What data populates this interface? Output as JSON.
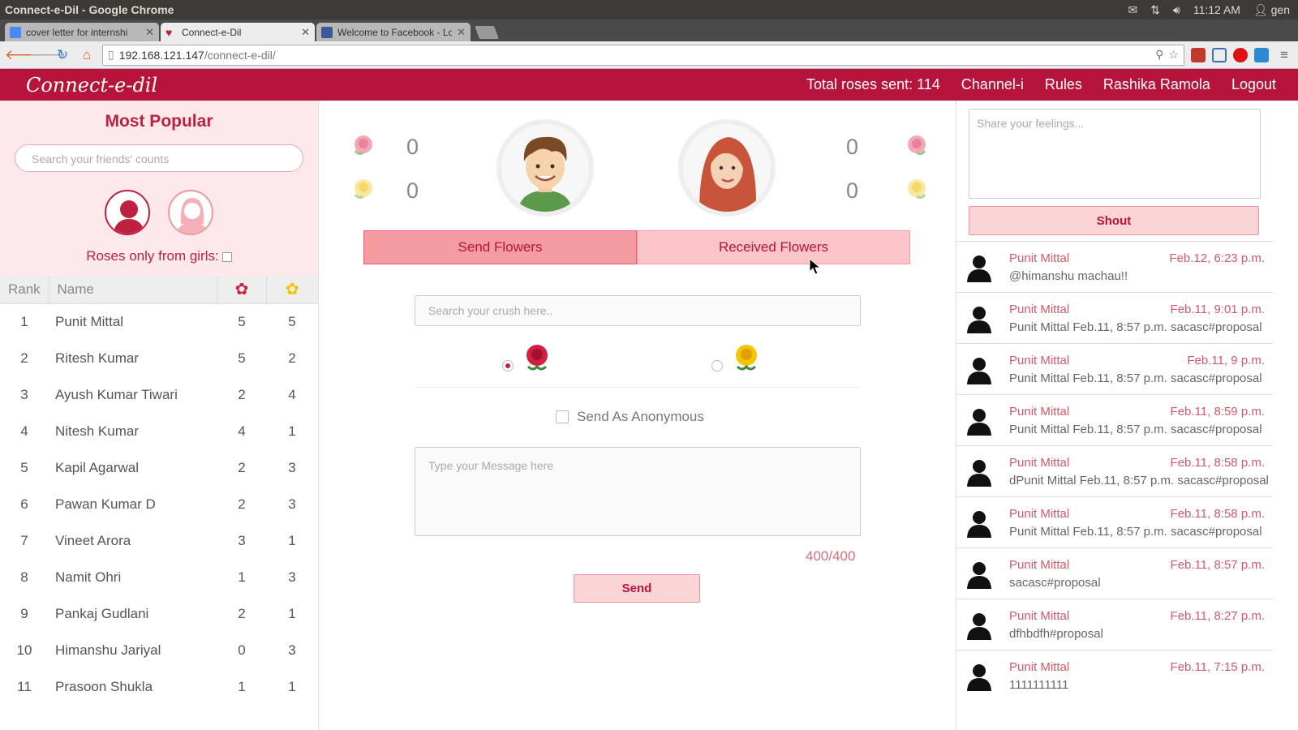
{
  "os": {
    "window_title": "Connect-e-Dil - Google Chrome",
    "time": "11:12 AM",
    "user": "gen"
  },
  "browser": {
    "tabs": [
      {
        "label": "cover letter for internshi",
        "active": false
      },
      {
        "label": "Connect-e-Dil",
        "active": true
      },
      {
        "label": "Welcome to Facebook - Lo",
        "active": false
      }
    ],
    "url_host": "192.168.121.147",
    "url_path": "/connect-e-dil/"
  },
  "header": {
    "logo": "Connect-e-dil",
    "nav": [
      "Total roses sent: 114",
      "Channel-i",
      "Rules",
      "Rashika Ramola",
      "Logout"
    ]
  },
  "left": {
    "title": "Most Popular",
    "search_placeholder": "Search your friends' counts",
    "roses_only_label": "Roses only from girls:",
    "columns": {
      "rank": "Rank",
      "name": "Name"
    },
    "rows": [
      {
        "rank": "1",
        "name": "Punit Mittal",
        "red": "5",
        "yellow": "5"
      },
      {
        "rank": "2",
        "name": "Ritesh Kumar",
        "red": "5",
        "yellow": "2"
      },
      {
        "rank": "3",
        "name": "Ayush Kumar Tiwari",
        "red": "2",
        "yellow": "4"
      },
      {
        "rank": "4",
        "name": "Nitesh Kumar",
        "red": "4",
        "yellow": "1"
      },
      {
        "rank": "5",
        "name": "Kapil Agarwal",
        "red": "2",
        "yellow": "3"
      },
      {
        "rank": "6",
        "name": "Pawan Kumar D",
        "red": "2",
        "yellow": "3"
      },
      {
        "rank": "7",
        "name": "Vineet Arora",
        "red": "3",
        "yellow": "1"
      },
      {
        "rank": "8",
        "name": "Namit Ohri",
        "red": "1",
        "yellow": "3"
      },
      {
        "rank": "9",
        "name": "Pankaj Gudlani",
        "red": "2",
        "yellow": "1"
      },
      {
        "rank": "10",
        "name": "Himanshu Jariyal",
        "red": "0",
        "yellow": "3"
      },
      {
        "rank": "11",
        "name": "Prasoon Shukla",
        "red": "1",
        "yellow": "1"
      }
    ]
  },
  "center": {
    "sent_red": "0",
    "sent_yellow": "0",
    "recv_red": "0",
    "recv_yellow": "0",
    "tab_send": "Send Flowers",
    "tab_received": "Received Flowers",
    "crush_placeholder": "Search your crush here..",
    "anonymous_label": "Send As Anonymous",
    "message_placeholder": "Type your Message here",
    "char_count": "400/400",
    "send_label": "Send"
  },
  "right": {
    "share_placeholder": "Share your feelings...",
    "shout_label": "Shout",
    "posts": [
      {
        "name": "Punit Mittal",
        "time": "Feb.12, 6:23 p.m.",
        "message": "@himanshu machau!!"
      },
      {
        "name": "Punit Mittal",
        "time": "Feb.11, 9:01 p.m.",
        "message": "Punit Mittal Feb.11, 8:57 p.m. sacasc#proposal"
      },
      {
        "name": "Punit Mittal",
        "time": "Feb.11, 9 p.m.",
        "message": "Punit Mittal Feb.11, 8:57 p.m. sacasc#proposal"
      },
      {
        "name": "Punit Mittal",
        "time": "Feb.11, 8:59 p.m.",
        "message": "Punit Mittal Feb.11, 8:57 p.m. sacasc#proposal"
      },
      {
        "name": "Punit Mittal",
        "time": "Feb.11, 8:58 p.m.",
        "message": "dPunit Mittal Feb.11, 8:57 p.m. sacasc#proposal"
      },
      {
        "name": "Punit Mittal",
        "time": "Feb.11, 8:58 p.m.",
        "message": "Punit Mittal Feb.11, 8:57 p.m. sacasc#proposal"
      },
      {
        "name": "Punit Mittal",
        "time": "Feb.11, 8:57 p.m.",
        "message": "sacasc#proposal"
      },
      {
        "name": "Punit Mittal",
        "time": "Feb.11, 8:27 p.m.",
        "message": "dfhbdfh#proposal"
      },
      {
        "name": "Punit Mittal",
        "time": "Feb.11, 7:15 p.m.",
        "message": "1111111111"
      }
    ]
  },
  "colors": {
    "brand": "#b7143c",
    "pink_bg": "#fde9ec",
    "red_rose": "#d12040",
    "yellow_rose": "#f5c400"
  }
}
